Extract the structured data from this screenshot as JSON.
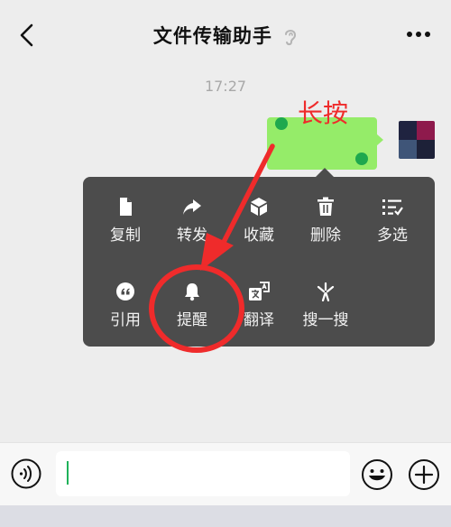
{
  "header": {
    "title": "文件传输助手"
  },
  "timestamp": "17:27",
  "annotation": {
    "label": "长按",
    "color": "#ef2b2b"
  },
  "message": {
    "bubble_color": "#95ec69"
  },
  "menu": {
    "row1": [
      {
        "icon": "copy-icon",
        "label": "复制"
      },
      {
        "icon": "forward-icon",
        "label": "转发"
      },
      {
        "icon": "favorite-icon",
        "label": "收藏"
      },
      {
        "icon": "delete-icon",
        "label": "删除"
      },
      {
        "icon": "multiselect-icon",
        "label": "多选"
      }
    ],
    "row2": [
      {
        "icon": "quote-icon",
        "label": "引用"
      },
      {
        "icon": "bell-icon",
        "label": "提醒"
      },
      {
        "icon": "translate-icon",
        "label": "翻译"
      },
      {
        "icon": "search-sparkle-icon",
        "label": "搜一搜"
      }
    ]
  },
  "input": {
    "value": "",
    "placeholder": ""
  },
  "colors": {
    "background": "#ededed",
    "menu": "#4c4c4c",
    "accent": "#1fb25a"
  }
}
